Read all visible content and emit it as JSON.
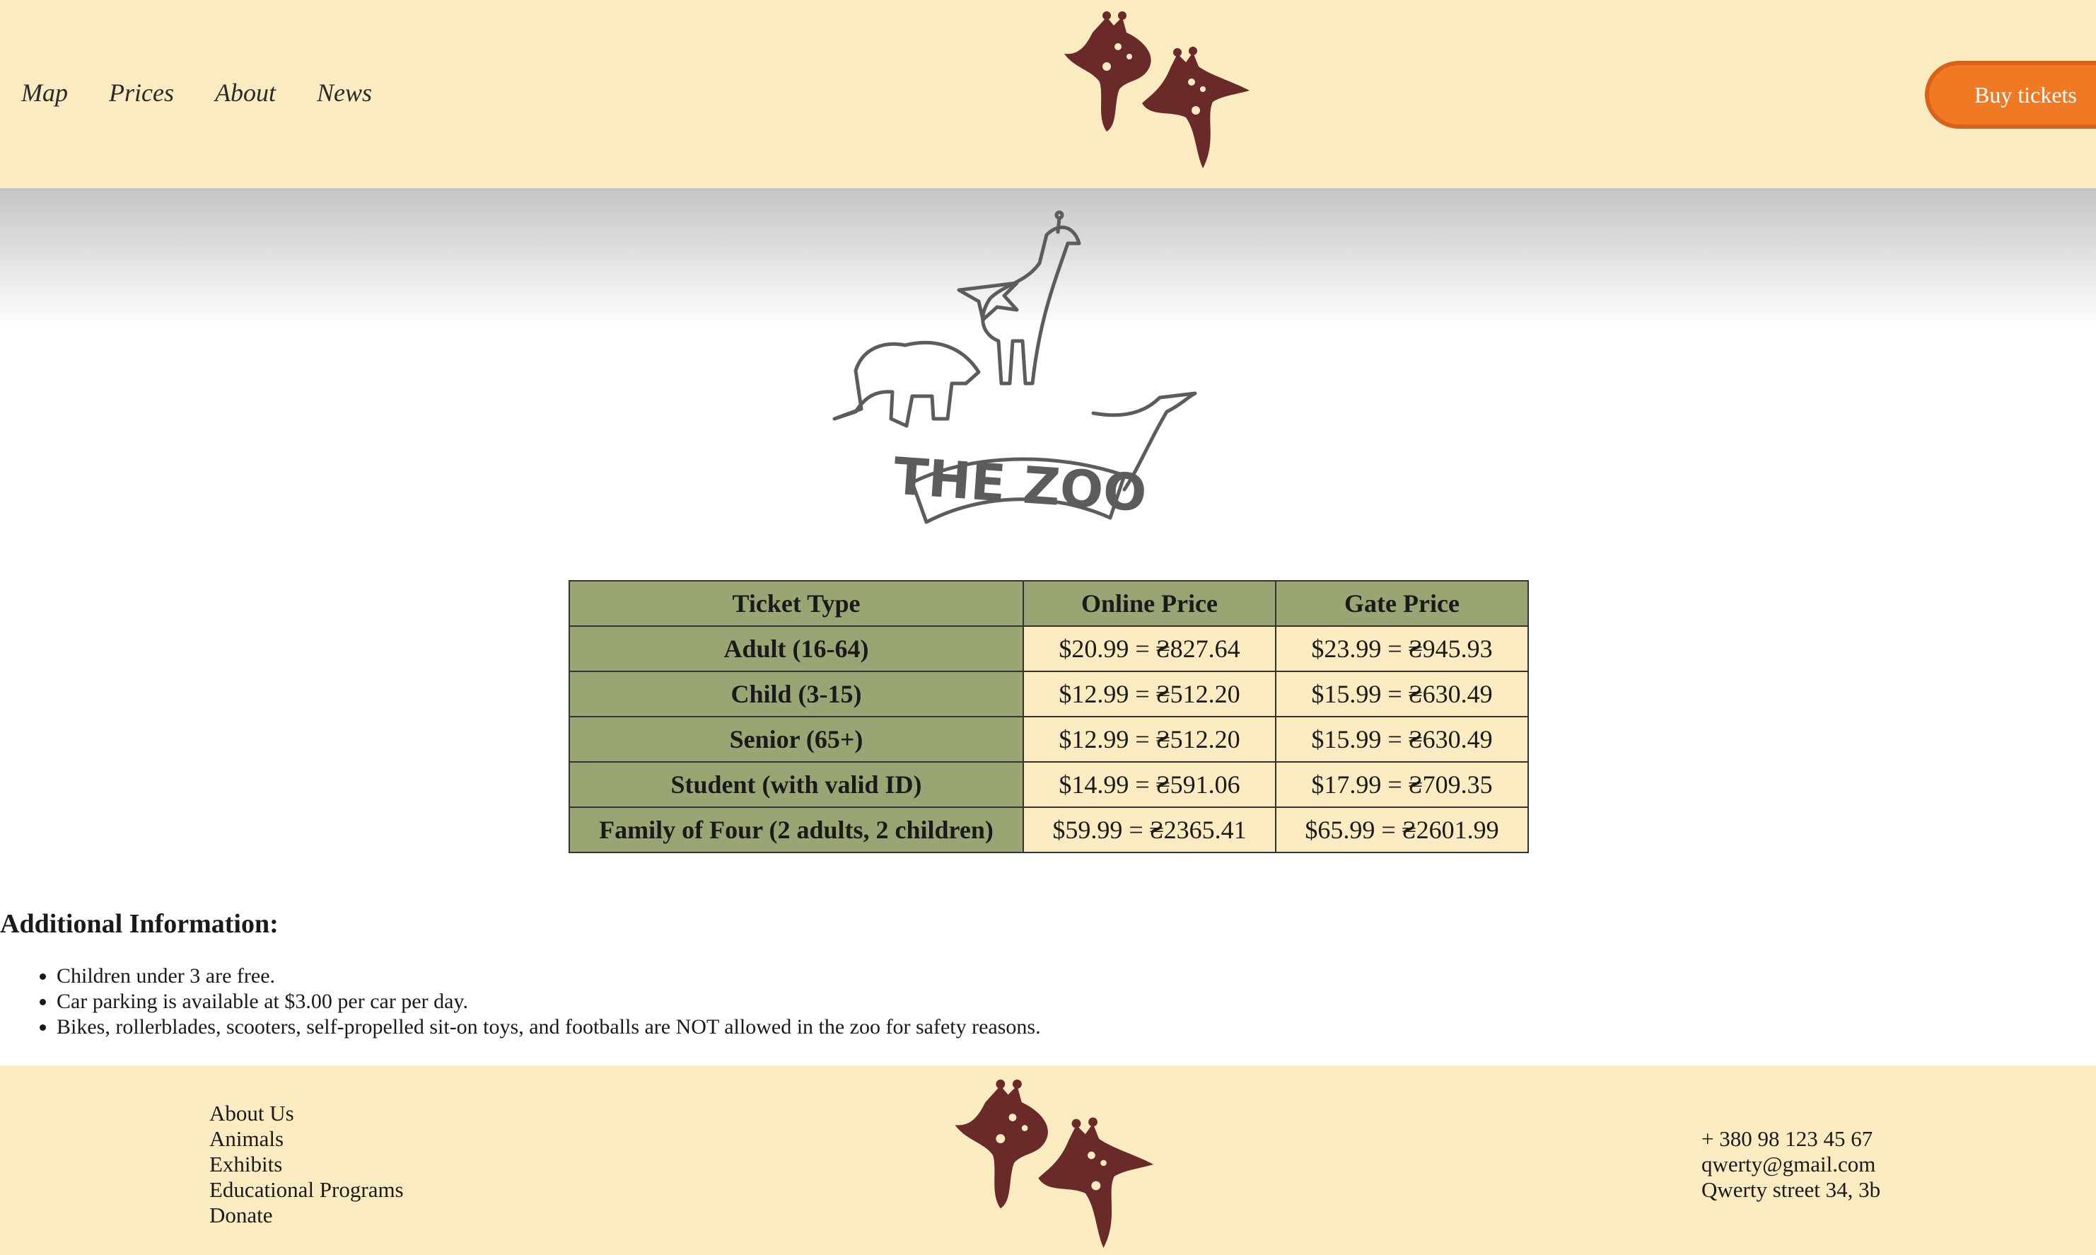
{
  "header": {
    "nav": [
      "Map",
      "Prices",
      "About",
      "News"
    ],
    "buy_label": "Buy tickets"
  },
  "hero": {
    "logo_text": "THE ZOO"
  },
  "table": {
    "headers": [
      "Ticket Type",
      "Online Price",
      "Gate Price"
    ],
    "rows": [
      {
        "type": "Adult (16-64)",
        "online": "$20.99 = ₴827.64",
        "gate": "$23.99 = ₴945.93"
      },
      {
        "type": "Child (3-15)",
        "online": "$12.99 = ₴512.20",
        "gate": "$15.99 = ₴630.49"
      },
      {
        "type": "Senior (65+)",
        "online": "$12.99 = ₴512.20",
        "gate": "$15.99 = ₴630.49"
      },
      {
        "type": "Student (with valid ID)",
        "online": "$14.99 = ₴591.06",
        "gate": "$17.99 = ₴709.35"
      },
      {
        "type": "Family of Four (2 adults, 2 children)",
        "online": "$59.99 = ₴2365.41",
        "gate": "$65.99 = ₴2601.99"
      }
    ]
  },
  "info": {
    "title": "Additional Information:",
    "items": [
      "Children under 3 are free.",
      "Car parking is available at $3.00 per car per day.",
      "Bikes, rollerblades, scooters, self-propelled sit-on toys, and footballs are NOT allowed in the zoo for safety reasons."
    ]
  },
  "footer": {
    "links": [
      "About Us",
      "Animals",
      "Exhibits",
      "Educational Programs",
      "Donate"
    ],
    "contact": [
      "+ 380 98 123 45 67",
      "qwerty@gmail.com",
      "Qwerty street 34, 3b"
    ]
  },
  "colors": {
    "cream": "#faecc0",
    "olive": "#9aa574",
    "orange": "#f07a24",
    "giraffe_brown": "#6b2a2a"
  }
}
